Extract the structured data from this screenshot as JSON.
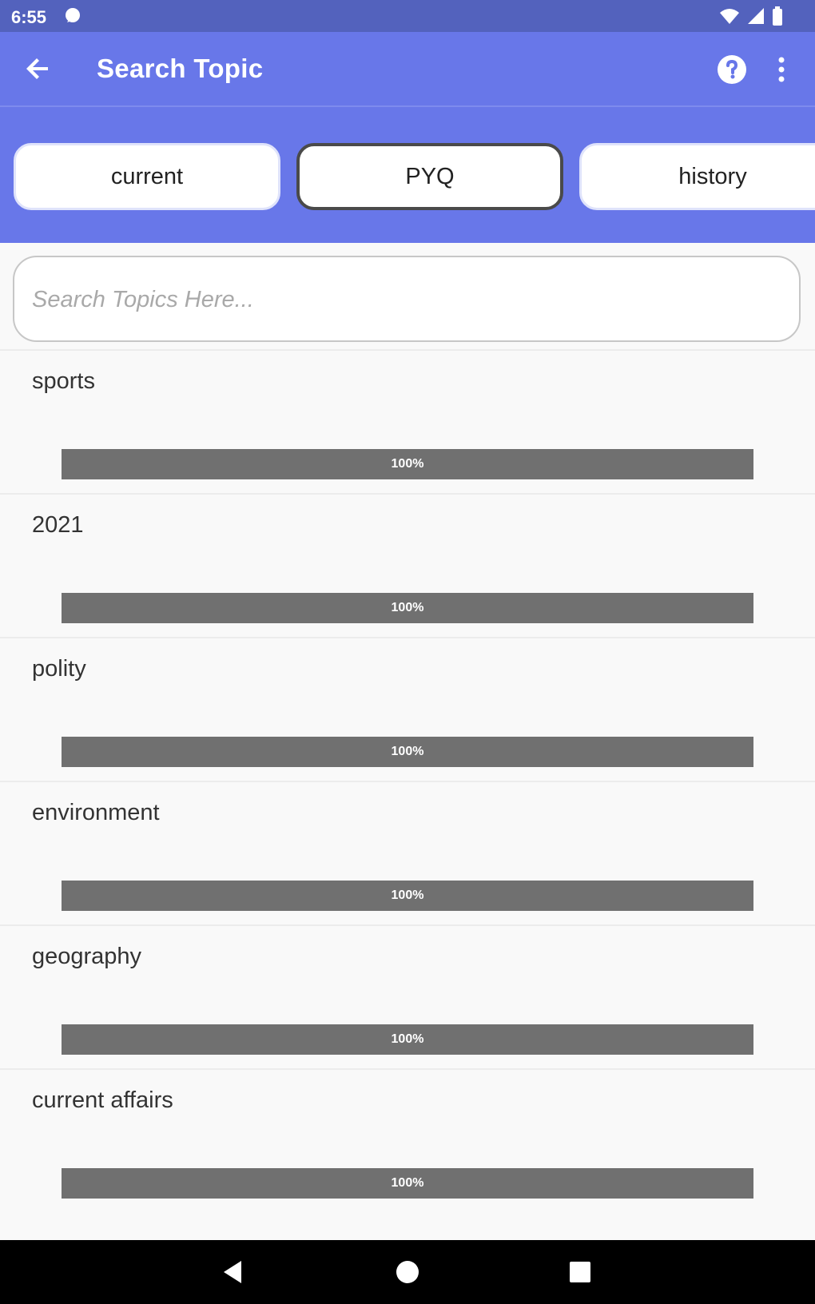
{
  "status_bar": {
    "time": "6:55",
    "icons": [
      "message-icon",
      "wifi-icon",
      "signal-icon",
      "battery-icon"
    ]
  },
  "app_bar": {
    "title": "Search Topic",
    "icons": [
      "back-arrow-icon",
      "help-icon",
      "more-vert-icon"
    ]
  },
  "chips": [
    {
      "label": "current",
      "selected": false
    },
    {
      "label": "PYQ",
      "selected": true
    },
    {
      "label": "history",
      "selected": false
    }
  ],
  "search": {
    "placeholder": "Search Topics Here...",
    "value": ""
  },
  "topics": [
    {
      "label": "sports",
      "progress_percent": 100,
      "progress_text": "100%"
    },
    {
      "label": "2021",
      "progress_percent": 100,
      "progress_text": "100%"
    },
    {
      "label": "polity",
      "progress_percent": 100,
      "progress_text": "100%"
    },
    {
      "label": "environment",
      "progress_percent": 100,
      "progress_text": "100%"
    },
    {
      "label": "geography",
      "progress_percent": 100,
      "progress_text": "100%"
    },
    {
      "label": "current affairs",
      "progress_percent": 100,
      "progress_text": "100%"
    }
  ],
  "colors": {
    "status_bar": "#5362bd",
    "app_bar": "#6877e9",
    "progress_fill": "#707070",
    "background": "#f9f9f9"
  },
  "nav_bar": {
    "icons": [
      "nav-back-icon",
      "nav-home-icon",
      "nav-recents-icon"
    ]
  }
}
